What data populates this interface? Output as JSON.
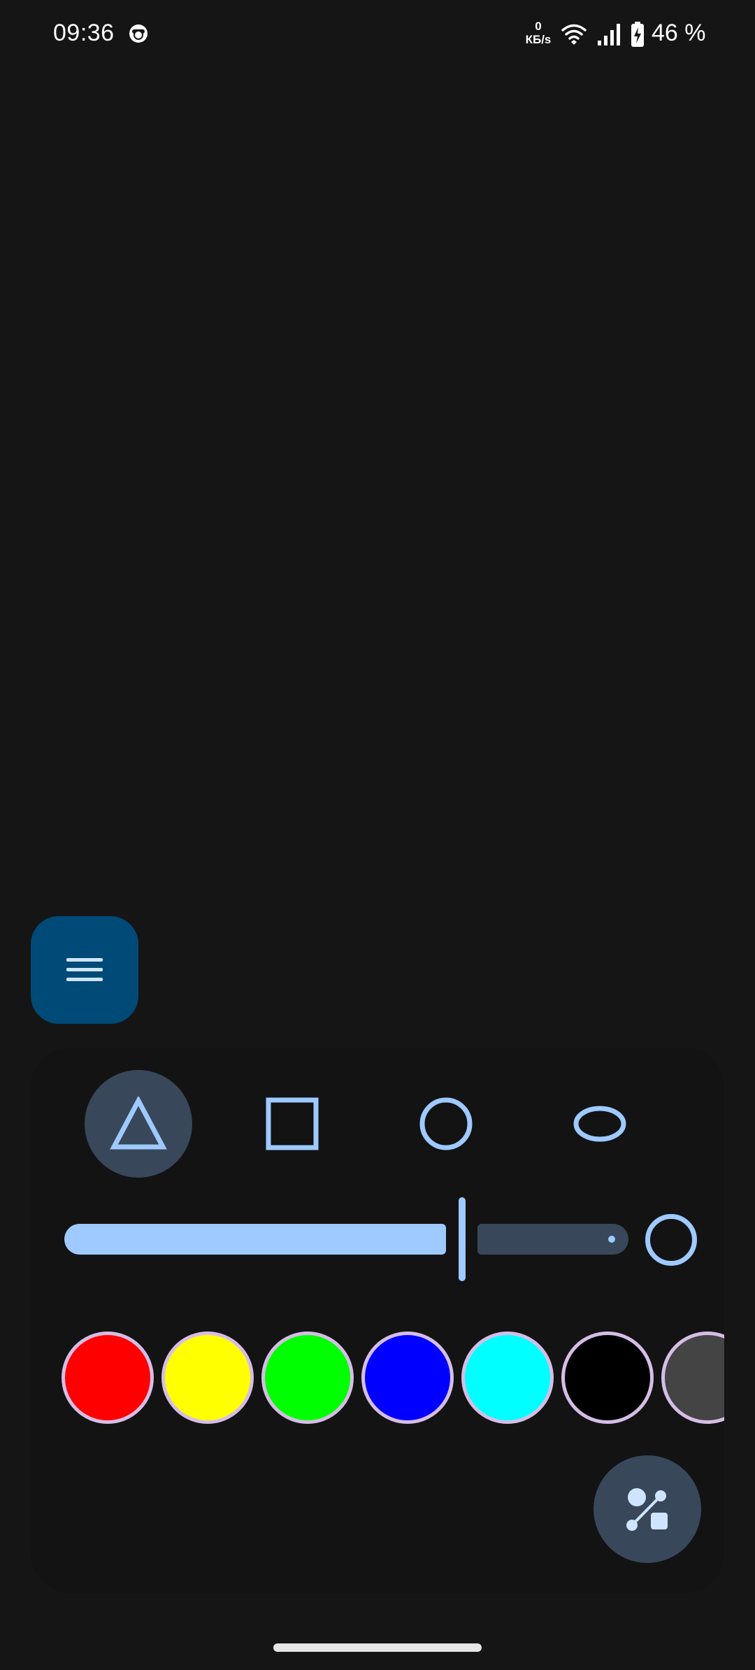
{
  "status_bar": {
    "time": "09:36",
    "net_speed_value": "0",
    "net_speed_unit": "КБ/s",
    "battery_percent": "46 %",
    "icons": [
      "notification-app-icon",
      "wifi-icon",
      "signal-icon",
      "battery-charging-icon"
    ]
  },
  "menu_button": {
    "icon": "menu-icon"
  },
  "shape_picker": {
    "selected": "triangle",
    "options": [
      {
        "id": "triangle",
        "icon": "triangle-icon"
      },
      {
        "id": "square",
        "icon": "square-icon"
      },
      {
        "id": "circle",
        "icon": "circle-icon"
      },
      {
        "id": "ellipse",
        "icon": "ellipse-icon"
      }
    ]
  },
  "size_slider": {
    "fraction": 0.72
  },
  "colors": {
    "accent": "#9ecaff",
    "accent_container": "#004a77",
    "selected_container": "#38485a",
    "swatch_outline": "#d6bde6",
    "palette": [
      "#ff0000",
      "#ffff00",
      "#00ff00",
      "#0000ff",
      "#00ffff",
      "#000000",
      "#444444"
    ]
  },
  "tool_button": {
    "icon": "shapes-tool-icon"
  }
}
